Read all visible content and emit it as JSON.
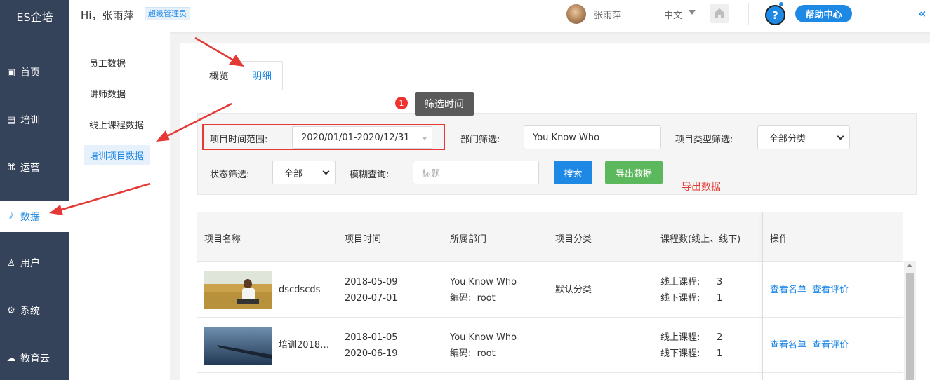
{
  "brand": {
    "title": "ES企培"
  },
  "header": {
    "greeting": "Hi，张雨萍",
    "role_badge": "超级管理员",
    "user_name": "张雨萍",
    "language": "中文",
    "help_label": "帮助中心",
    "help_q": "?"
  },
  "nav": {
    "items": [
      {
        "label": "首页",
        "icon": "dashboard-icon",
        "glyph": "▣"
      },
      {
        "label": "培训",
        "icon": "training-icon",
        "glyph": "▤"
      },
      {
        "label": "运营",
        "icon": "operations-icon",
        "glyph": "⌘"
      },
      {
        "label": "数据",
        "icon": "data-icon",
        "glyph": "⫽",
        "active": true
      },
      {
        "label": "用户",
        "icon": "user-icon",
        "glyph": "♙"
      },
      {
        "label": "系统",
        "icon": "system-icon",
        "glyph": "⚙"
      },
      {
        "label": "教育云",
        "icon": "cloud-icon",
        "glyph": "☁"
      }
    ]
  },
  "subnav": {
    "items": [
      {
        "label": "员工数据"
      },
      {
        "label": "讲师数据"
      },
      {
        "label": "线上课程数据"
      },
      {
        "label": "培训项目数据",
        "active": true
      }
    ]
  },
  "tabs": {
    "overview": "概览",
    "detail": "明细"
  },
  "tip": {
    "badge": "1",
    "text": "筛选时间"
  },
  "filters": {
    "time_range_label": "项目时间范围:",
    "time_range_value": "2020/01/01-2020/12/31",
    "dept_label": "部门筛选:",
    "dept_value": "You Know Who",
    "type_label": "项目类型筛选:",
    "type_value": "全部分类",
    "status_label": "状态筛选:",
    "status_value": "全部",
    "fuzzy_label": "模糊查询:",
    "fuzzy_placeholder": "标题",
    "search_button": "搜索",
    "export_button": "导出数据",
    "export_note": "导出数据"
  },
  "table": {
    "headers": [
      "项目名称",
      "项目时间",
      "所属部门",
      "项目分类",
      "课程数(线上、线下)",
      "操作"
    ],
    "rows": [
      {
        "name": "dscdscds",
        "start": "2018-05-09",
        "end": "2020-07-01",
        "dept": "You Know Who",
        "code": "编码:  root",
        "category": "默认分类",
        "online_label": "线上课程:",
        "online_count": "3",
        "offline_label": "线下课程:",
        "offline_count": "1",
        "action_list": "查看名单",
        "action_review": "查看评价"
      },
      {
        "name": "培训2018…",
        "start": "2018-01-05",
        "end": "2020-06-19",
        "dept": "You Know Who",
        "code": "编码:  root",
        "category": "",
        "online_label": "线上课程:",
        "online_count": "2",
        "offline_label": "线下课程:",
        "offline_count": "1",
        "action_list": "查看名单",
        "action_review": "查看评价"
      }
    ]
  }
}
